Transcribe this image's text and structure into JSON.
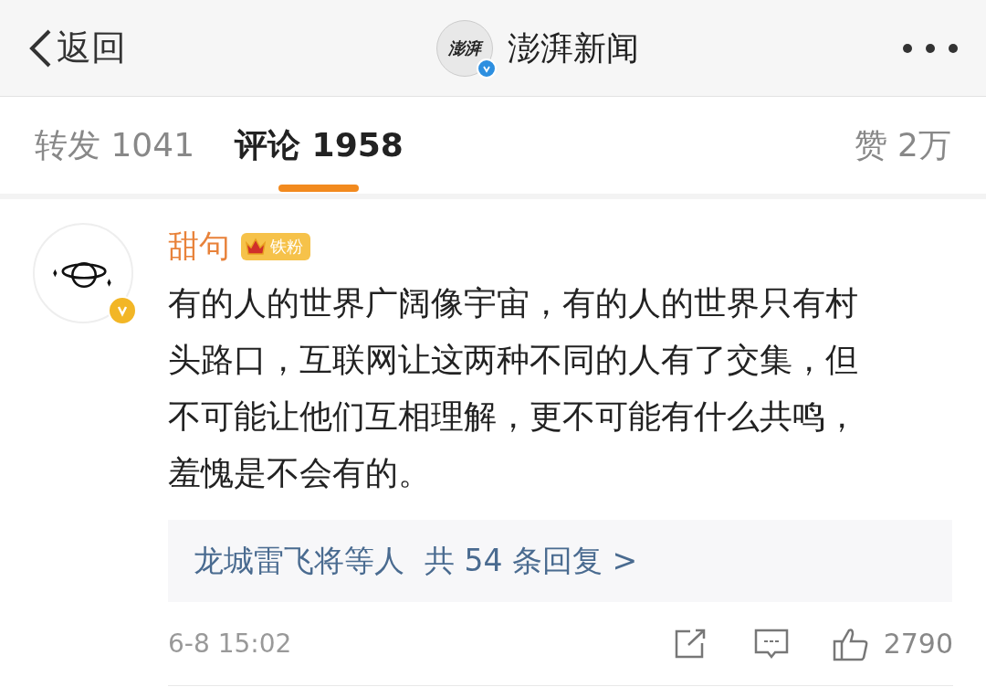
{
  "header": {
    "back": "返回",
    "logo_text": "澎湃",
    "title": "澎湃新闻",
    "verified": true
  },
  "tabs": [
    {
      "label": "转发 1041",
      "selected": false
    },
    {
      "label": "评论 1958",
      "selected": true
    }
  ],
  "likes_tab": "赞 2万",
  "comment": {
    "author": "甜句",
    "verified": true,
    "badge": "铁粉",
    "lines": [
      "有的人的世界广阔像宇宙，有的人的世界只有村",
      "头路口，互联网让这两种不同的人有了交集，但",
      "不可能让他们互相理解，更不可能有什么共鸣，",
      "羞愧是不会有的。"
    ],
    "replies": {
      "names": "龙城雷飞将等人",
      "count": "共 54 条回复 >"
    },
    "time": "6-8 15:02",
    "likes": "2790"
  }
}
